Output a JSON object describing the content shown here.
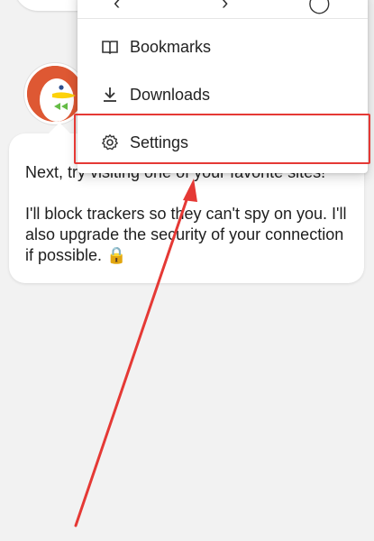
{
  "bubble": {
    "line1": "Next, try visiting one of your favorite sites!",
    "line2": "I'll block trackers so they can't spy on you. I'll also upgrade the security of your connection if possible. 🔒"
  },
  "menu": {
    "items": [
      {
        "label": "Bookmarks",
        "icon": "bookmarks-icon"
      },
      {
        "label": "Downloads",
        "icon": "download-icon"
      },
      {
        "label": "Settings",
        "icon": "gear-icon"
      }
    ]
  },
  "colors": {
    "brand": "#de5833",
    "highlight": "#e53935",
    "background": "#f2f2f2"
  }
}
